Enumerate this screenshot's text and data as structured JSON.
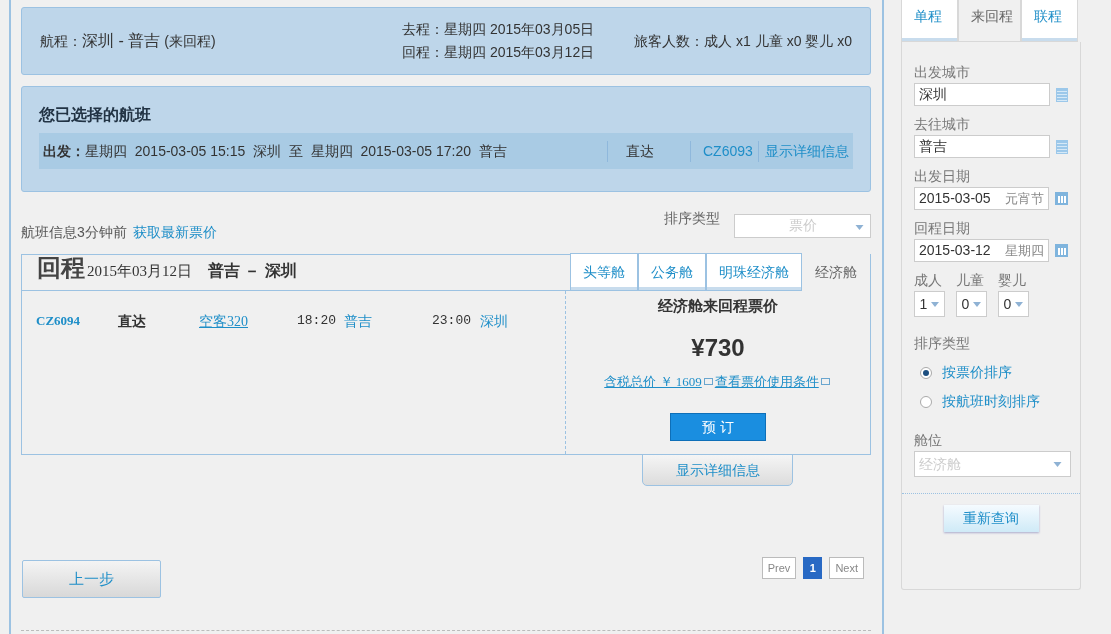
{
  "itinerary": {
    "route_label": "航程：",
    "route": "深圳 - 普吉",
    "trip_type": "(来回程)",
    "outbound": "去程：星期四 2015年03月05日",
    "return": "回程：星期四 2015年03月12日",
    "passengers": "旅客人数：成人 x1 儿童 x0 婴儿 x0"
  },
  "selected_flight": {
    "title": "您已选择的航班",
    "label": "出发：",
    "schedule": "星期四  2015-03-05 15:15  深圳  至  星期四  2015-03-05 17:20  普吉",
    "stops": "直达",
    "flight_no": "CZ6093",
    "details_link": "显示详细信息"
  },
  "update_note": "航班信息3分钟前",
  "refresh_link": "获取最新票价",
  "sort": {
    "label": "排序类型",
    "value": "票价"
  },
  "return_leg": {
    "title": "回程",
    "date": "2015年03月12日",
    "route": "普吉 － 深圳",
    "cabin_tabs": [
      {
        "label": "头等舱",
        "selected": false
      },
      {
        "label": "公务舱",
        "selected": false
      },
      {
        "label": "明珠经济舱",
        "selected": false
      },
      {
        "label": "经济舱",
        "selected": true
      }
    ],
    "flight": {
      "number": "CZ6094",
      "stops": "直达",
      "aircraft": "空客320",
      "depart_time": "18:20",
      "depart_city": "普吉",
      "arrive_time": "23:00",
      "arrive_city": "深圳"
    },
    "fare": {
      "title": "经济舱来回程票价",
      "price": "¥730",
      "tax_link": "含税总价 ￥ 1609",
      "rules_link": "查看票价使用条件",
      "book_button": "预 订"
    },
    "details_button": "显示详细信息"
  },
  "back_button": "上一步",
  "pagination": {
    "prev": "Prev",
    "pages": [
      {
        "label": "1",
        "selected": true
      }
    ],
    "next": "Next"
  },
  "sidebar": {
    "trip_tabs": [
      {
        "label": "单程",
        "selected": false
      },
      {
        "label": "来回程",
        "selected": true
      },
      {
        "label": "联程",
        "selected": false
      }
    ],
    "fields": [
      {
        "kind": "city",
        "label": "出发城市",
        "value": "深圳"
      },
      {
        "kind": "city",
        "label": "去往城市",
        "value": "普吉"
      },
      {
        "kind": "date",
        "label": "出发日期",
        "value": "2015-03-05",
        "note": "元宵节"
      },
      {
        "kind": "date",
        "label": "回程日期",
        "value": "2015-03-12",
        "note": "星期四"
      }
    ],
    "passengers": [
      {
        "label": "成人",
        "value": "1"
      },
      {
        "label": "儿童",
        "value": "0"
      },
      {
        "label": "婴儿",
        "value": "0"
      }
    ],
    "sort_label": "排序类型",
    "sort_options": [
      {
        "label": "按票价排序",
        "selected": true
      },
      {
        "label": "按航班时刻排序",
        "selected": false
      }
    ],
    "cabin_label": "舱位",
    "cabin_value": "经济舱",
    "search_button": "重新查询"
  }
}
